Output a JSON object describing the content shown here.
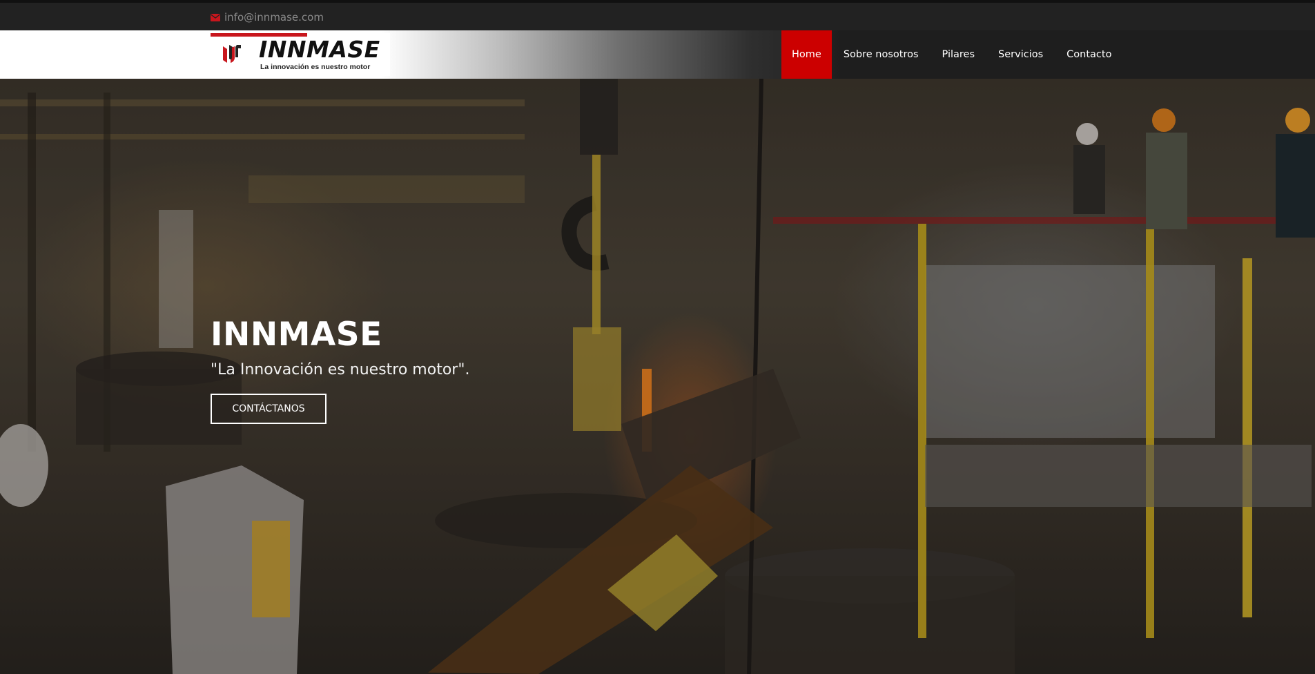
{
  "topbar": {
    "email": "info@innmase.com",
    "email_icon": "envelope-icon"
  },
  "logo": {
    "wordmark": "INNMASE",
    "tagline": "La innovación es nuestro motor",
    "brand_color": "#c8161d"
  },
  "nav": {
    "active_color": "#cc0000",
    "items": [
      {
        "label": "Home",
        "active": true
      },
      {
        "label": "Sobre nosotros",
        "active": false
      },
      {
        "label": "Pilares",
        "active": false
      },
      {
        "label": "Servicios",
        "active": false
      },
      {
        "label": "Contacto",
        "active": false
      }
    ]
  },
  "hero": {
    "title": "INNMASE",
    "subtitle": "\"La Innovación es nuestro motor\".",
    "button_label": "CONTÁCTANOS",
    "background": "industrial-foundry-photo"
  }
}
